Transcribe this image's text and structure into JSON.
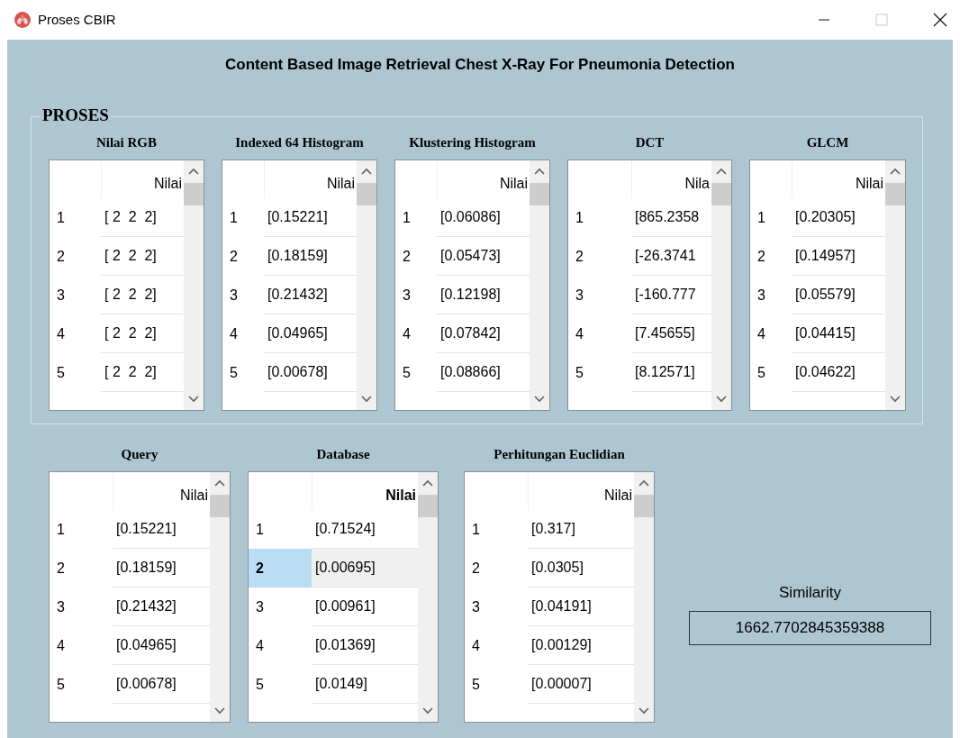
{
  "window": {
    "title": "Proses CBIR"
  },
  "heading": "Content Based Image Retrieval Chest X-Ray For Pneumonia Detection",
  "group": {
    "title": "PROSES",
    "tables": [
      {
        "title": "Nilai RGB",
        "header": "Nilai",
        "header_bold": false,
        "rows": [
          {
            "index": "1",
            "value": "[ 2  2  2]",
            "selected": false
          },
          {
            "index": "2",
            "value": "[ 2  2  2]",
            "selected": false
          },
          {
            "index": "3",
            "value": "[ 2  2  2]",
            "selected": false
          },
          {
            "index": "4",
            "value": "[ 2  2  2]",
            "selected": false
          },
          {
            "index": "5",
            "value": "[ 2  2  2]",
            "selected": false
          }
        ]
      },
      {
        "title": "Indexed 64 Histogram",
        "header": "Nilai",
        "header_bold": false,
        "rows": [
          {
            "index": "1",
            "value": "[0.15221]",
            "selected": false
          },
          {
            "index": "2",
            "value": "[0.18159]",
            "selected": false
          },
          {
            "index": "3",
            "value": "[0.21432]",
            "selected": false
          },
          {
            "index": "4",
            "value": "[0.04965]",
            "selected": false
          },
          {
            "index": "5",
            "value": "[0.00678]",
            "selected": false
          }
        ]
      },
      {
        "title": "Klustering Histogram",
        "header": "Nilai",
        "header_bold": false,
        "rows": [
          {
            "index": "1",
            "value": "[0.06086]",
            "selected": false
          },
          {
            "index": "2",
            "value": "[0.05473]",
            "selected": false
          },
          {
            "index": "3",
            "value": "[0.12198]",
            "selected": false
          },
          {
            "index": "4",
            "value": "[0.07842]",
            "selected": false
          },
          {
            "index": "5",
            "value": "[0.08866]",
            "selected": false
          }
        ]
      },
      {
        "title": "DCT",
        "header": "Nila",
        "header_bold": false,
        "rows": [
          {
            "index": "1",
            "value": "[865.2358",
            "selected": false
          },
          {
            "index": "2",
            "value": "[-26.3741",
            "selected": false
          },
          {
            "index": "3",
            "value": "[-160.777",
            "selected": false
          },
          {
            "index": "4",
            "value": "[7.45655]",
            "selected": false
          },
          {
            "index": "5",
            "value": "[8.12571]",
            "selected": false
          }
        ]
      },
      {
        "title": "GLCM",
        "header": "Nilai",
        "header_bold": false,
        "rows": [
          {
            "index": "1",
            "value": "[0.20305]",
            "selected": false
          },
          {
            "index": "2",
            "value": "[0.14957]",
            "selected": false
          },
          {
            "index": "3",
            "value": "[0.05579]",
            "selected": false
          },
          {
            "index": "4",
            "value": "[0.04415]",
            "selected": false
          },
          {
            "index": "5",
            "value": "[0.04622]",
            "selected": false
          }
        ]
      }
    ]
  },
  "bottom_tables": [
    {
      "title": "Query",
      "header": "Nilai",
      "header_bold": false,
      "rows": [
        {
          "index": "1",
          "value": "[0.15221]",
          "selected": false
        },
        {
          "index": "2",
          "value": "[0.18159]",
          "selected": false
        },
        {
          "index": "3",
          "value": "[0.21432]",
          "selected": false
        },
        {
          "index": "4",
          "value": "[0.04965]",
          "selected": false
        },
        {
          "index": "5",
          "value": "[0.00678]",
          "selected": false
        }
      ]
    },
    {
      "title": "Database",
      "header": "Nilai",
      "header_bold": true,
      "rows": [
        {
          "index": "1",
          "value": "[0.71524]",
          "selected": false
        },
        {
          "index": "2",
          "value": "[0.00695]",
          "selected": true
        },
        {
          "index": "3",
          "value": "[0.00961]",
          "selected": false
        },
        {
          "index": "4",
          "value": "[0.01369]",
          "selected": false
        },
        {
          "index": "5",
          "value": "[0.0149]",
          "selected": false
        }
      ]
    },
    {
      "title": "Perhitungan Euclidian",
      "header": "Nilai",
      "header_bold": false,
      "rows": [
        {
          "index": "1",
          "value": "[0.317]",
          "selected": false
        },
        {
          "index": "2",
          "value": "[0.0305]",
          "selected": false
        },
        {
          "index": "3",
          "value": "[0.04191]",
          "selected": false
        },
        {
          "index": "4",
          "value": "[0.00129]",
          "selected": false
        },
        {
          "index": "5",
          "value": "[0.00007]",
          "selected": false
        }
      ]
    }
  ],
  "similarity": {
    "label": "Similarity",
    "value": "1662.7702845359388"
  }
}
